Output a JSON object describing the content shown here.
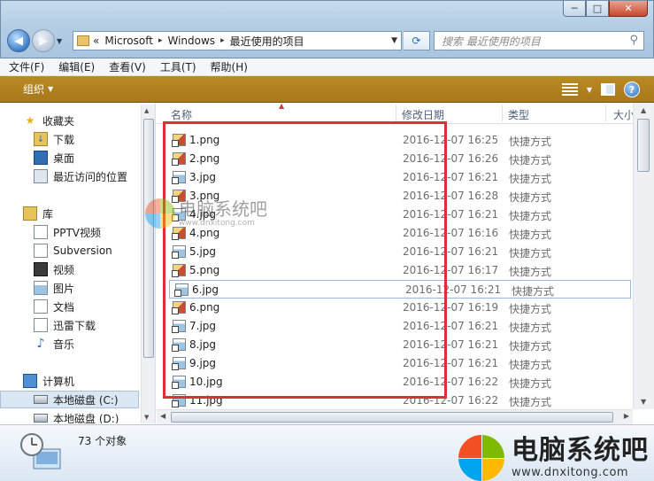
{
  "window": {
    "caption_min": "─",
    "caption_max": "□",
    "caption_close": "✕"
  },
  "nav": {
    "back_glyph": "◀",
    "forward_glyph": "▶"
  },
  "address": {
    "chevrons": "«",
    "segments": [
      "Microsoft",
      "Windows",
      "最近使用的项目"
    ],
    "separator": "▸"
  },
  "search": {
    "placeholder": "搜索 最近使用的项目"
  },
  "menubar": {
    "items": [
      "文件(F)",
      "编辑(E)",
      "查看(V)",
      "工具(T)",
      "帮助(H)"
    ]
  },
  "commandbar": {
    "organize_label": "组织",
    "help_label": "?"
  },
  "navpane": {
    "favorites_label": "收藏夹",
    "favorites": [
      "下载",
      "桌面",
      "最近访问的位置"
    ],
    "libraries_label": "库",
    "libraries": [
      "PPTV视频",
      "Subversion",
      "视频",
      "图片",
      "文档",
      "迅雷下载",
      "音乐"
    ],
    "computer_label": "计算机",
    "drives": [
      "本地磁盘 (C:)",
      "本地磁盘 (D:)"
    ]
  },
  "columns": {
    "name": "名称",
    "date": "修改日期",
    "type": "类型",
    "size": "大小"
  },
  "files": [
    {
      "name": "1.png",
      "date": "2016-12-07 16:25",
      "type": "快捷方式",
      "kind": "png"
    },
    {
      "name": "2.png",
      "date": "2016-12-07 16:26",
      "type": "快捷方式",
      "kind": "png"
    },
    {
      "name": "3.jpg",
      "date": "2016-12-07 16:21",
      "type": "快捷方式",
      "kind": "jpg"
    },
    {
      "name": "3.png",
      "date": "2016-12-07 16:28",
      "type": "快捷方式",
      "kind": "png"
    },
    {
      "name": "4.jpg",
      "date": "2016-12-07 16:21",
      "type": "快捷方式",
      "kind": "jpg"
    },
    {
      "name": "4.png",
      "date": "2016-12-07 16:16",
      "type": "快捷方式",
      "kind": "png"
    },
    {
      "name": "5.jpg",
      "date": "2016-12-07 16:21",
      "type": "快捷方式",
      "kind": "jpg"
    },
    {
      "name": "5.png",
      "date": "2016-12-07 16:17",
      "type": "快捷方式",
      "kind": "png"
    },
    {
      "name": "6.jpg",
      "date": "2016-12-07 16:21",
      "type": "快捷方式",
      "kind": "jpg",
      "focused": true
    },
    {
      "name": "6.png",
      "date": "2016-12-07 16:19",
      "type": "快捷方式",
      "kind": "png"
    },
    {
      "name": "7.jpg",
      "date": "2016-12-07 16:21",
      "type": "快捷方式",
      "kind": "jpg"
    },
    {
      "name": "8.jpg",
      "date": "2016-12-07 16:21",
      "type": "快捷方式",
      "kind": "jpg"
    },
    {
      "name": "9.jpg",
      "date": "2016-12-07 16:21",
      "type": "快捷方式",
      "kind": "jpg"
    },
    {
      "name": "10.jpg",
      "date": "2016-12-07 16:22",
      "type": "快捷方式",
      "kind": "jpg"
    },
    {
      "name": "11.jpg",
      "date": "2016-12-07 16:22",
      "type": "快捷方式",
      "kind": "jpg"
    }
  ],
  "status": {
    "item_count": "73 个对象"
  },
  "watermark": {
    "title": "电脑系统吧",
    "url": "www.dnxitong.com"
  },
  "brand": {
    "title": "电脑系统吧",
    "url": "www.dnxitong.com"
  },
  "colors": {
    "command_bar": "#b07f1f",
    "highlight_box": "#d9303a",
    "selection": "#dbe6f3"
  }
}
